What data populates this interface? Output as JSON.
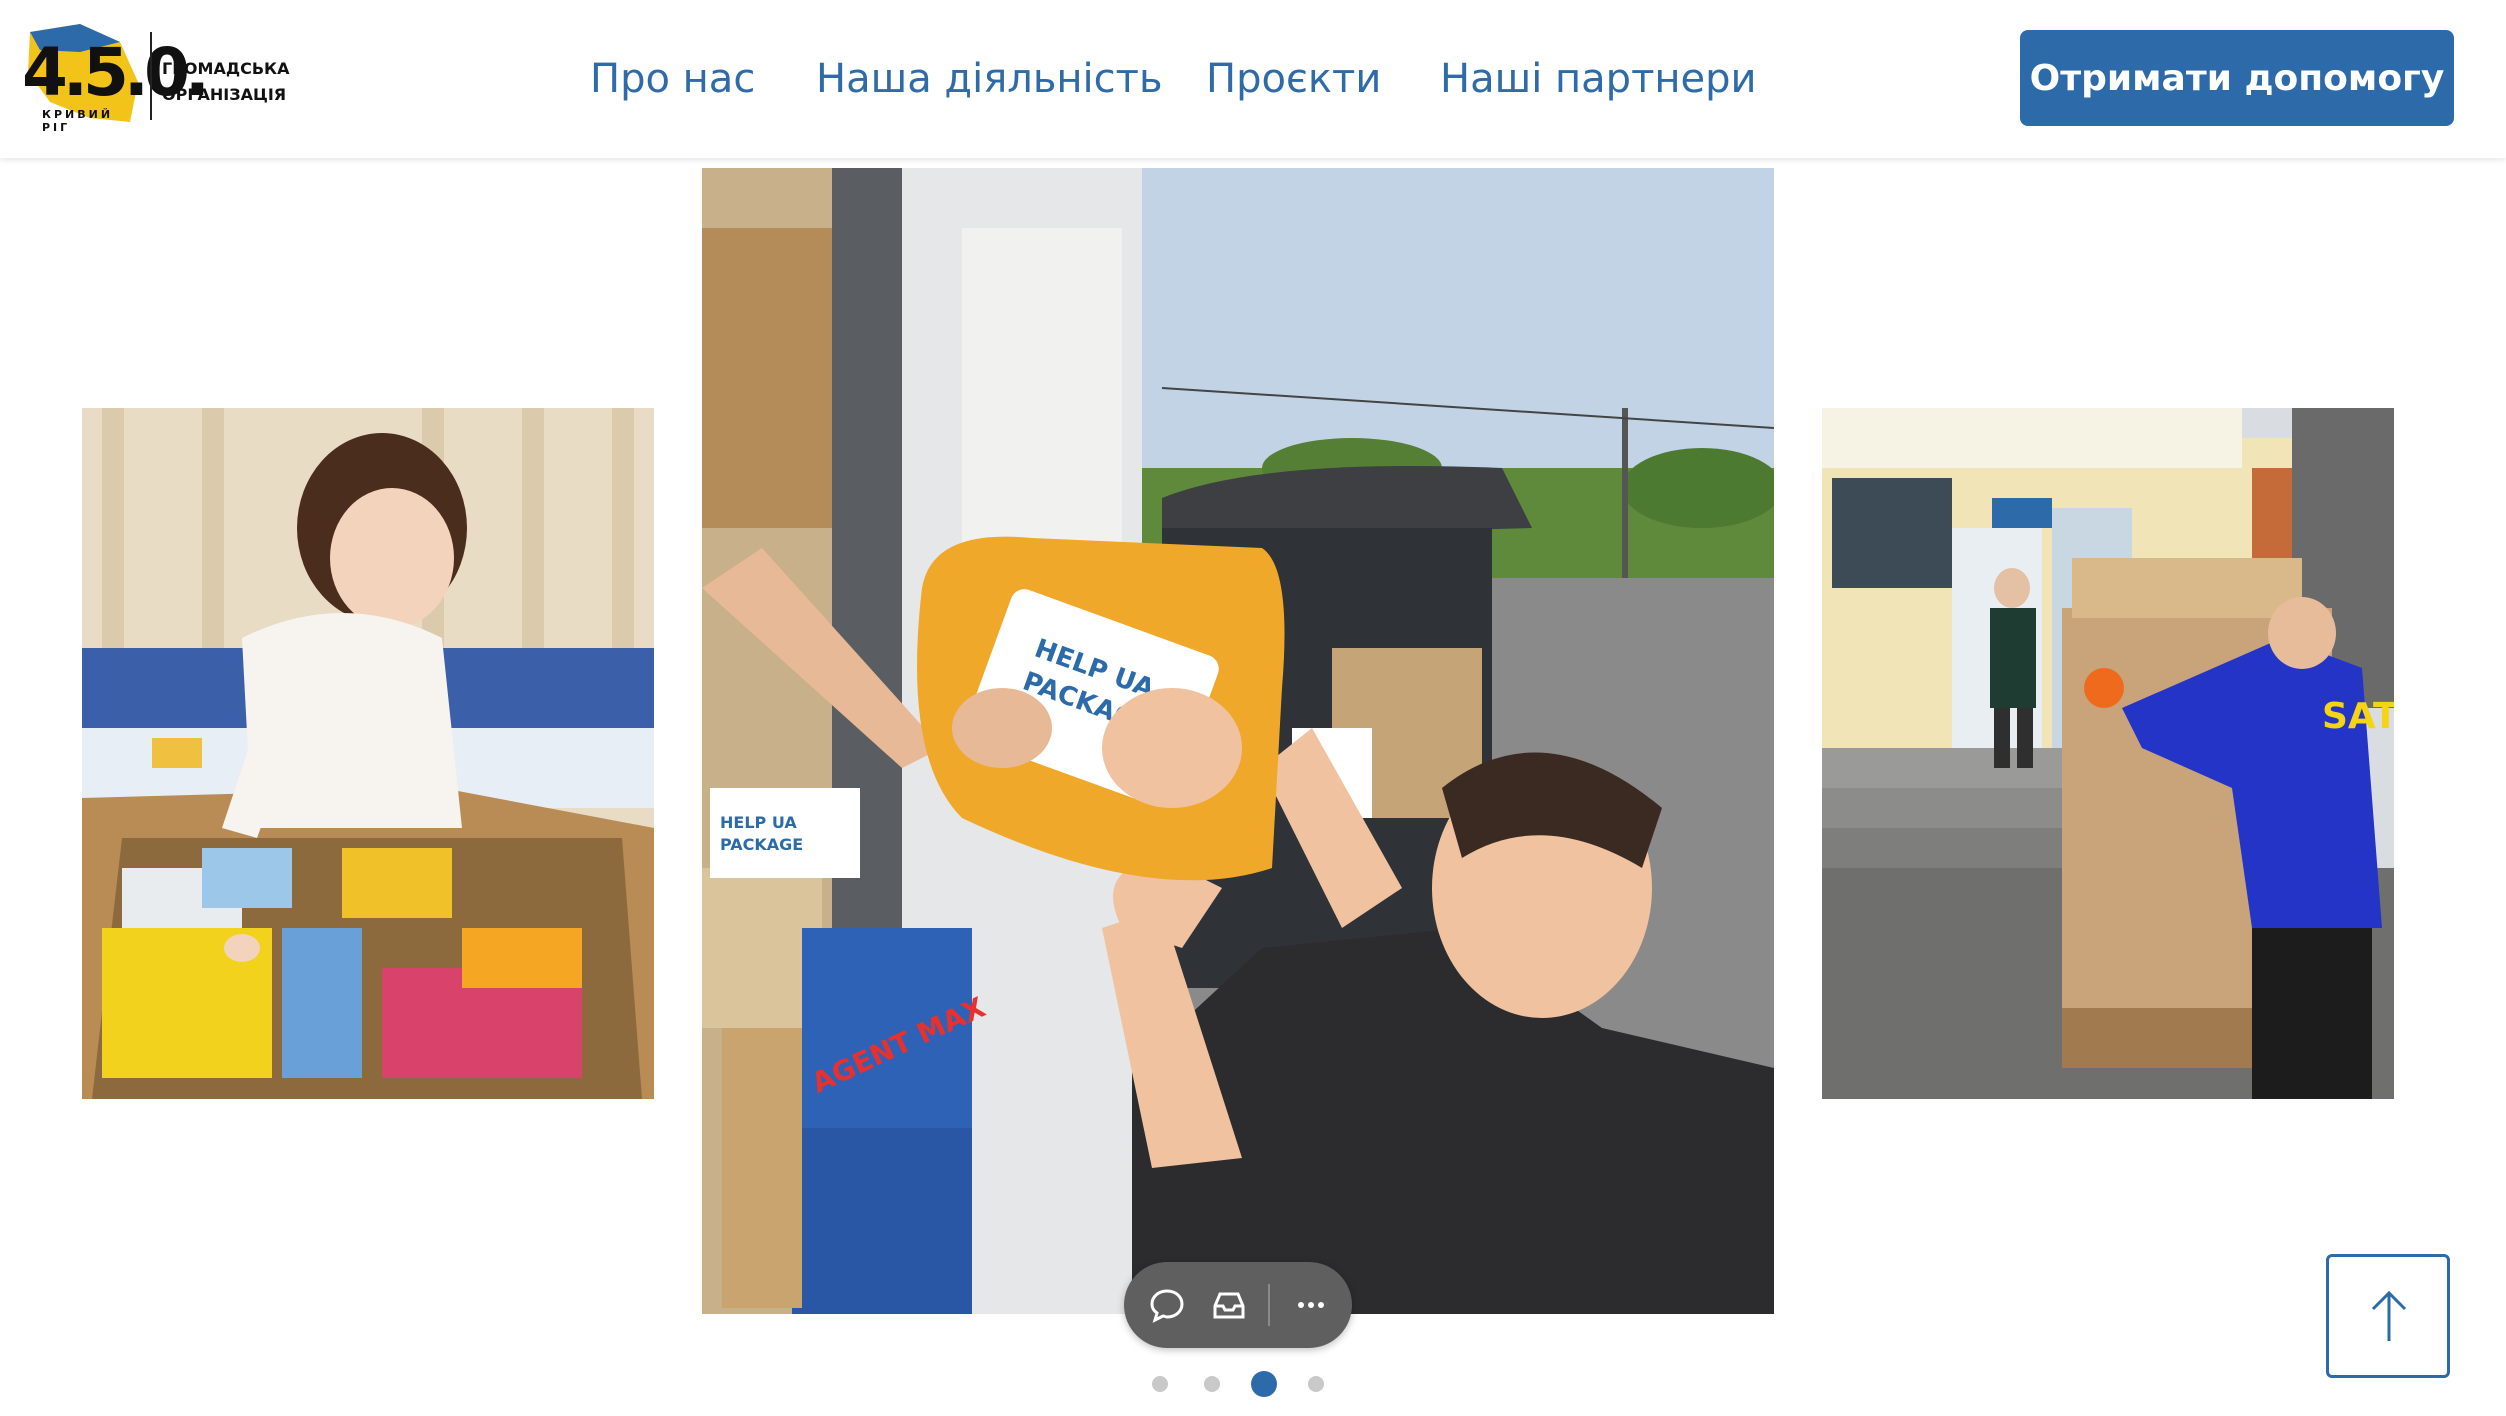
{
  "header": {
    "logo": {
      "number": "4.5.0.",
      "city": "КРИВИЙ РІГ",
      "org_line1": "ГРОМАДСЬКА",
      "org_line2": "ОРГАНІЗАЦІЯ"
    },
    "nav": [
      {
        "label": "Про нас"
      },
      {
        "label": "Наша діяльність"
      },
      {
        "label": "Проєкти"
      },
      {
        "label": "Наші партнери"
      }
    ],
    "cta_label": "Отримати допомогу"
  },
  "carousel": {
    "slides": [
      {
        "name": "child-with-aid-box"
      },
      {
        "name": "volunteer-loading-help-ua-package"
      },
      {
        "name": "worker-moving-pallet"
      }
    ],
    "center_photo_text": {
      "package_label": "HELP UA PACKAGE",
      "box_label": "HELP UA PACKAGE",
      "brand": "AGENT MAX",
      "jacket_logo": "SAT"
    },
    "dots_count": 4,
    "active_dot": 3
  },
  "toolbar": {
    "icons": [
      "comment-icon",
      "inbox-icon",
      "more-icon"
    ]
  },
  "colors": {
    "accent": "#2c6aaa",
    "nav_text": "#2f6ba8",
    "toolbar_bg": "#5f5f5f"
  }
}
